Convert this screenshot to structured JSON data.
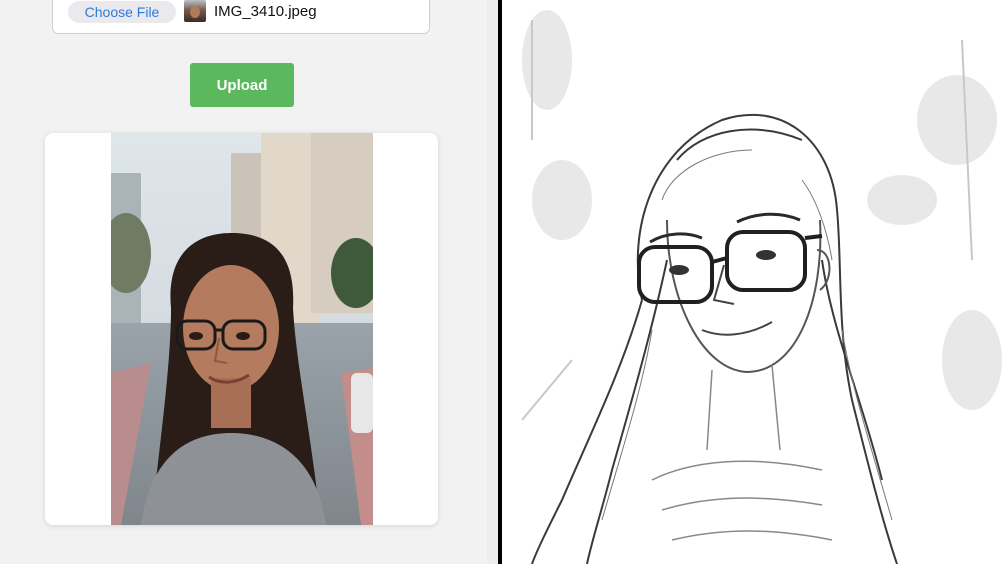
{
  "upload_form": {
    "choose_file_label": "Choose File",
    "file_name": "IMG_3410.jpeg",
    "upload_label": "Upload"
  },
  "colors": {
    "upload_button": "#5cb85c",
    "choose_file_text": "#2f7ad9",
    "divider": "#000000"
  },
  "icons": {
    "file_thumbnail": "image-thumbnail-icon"
  }
}
